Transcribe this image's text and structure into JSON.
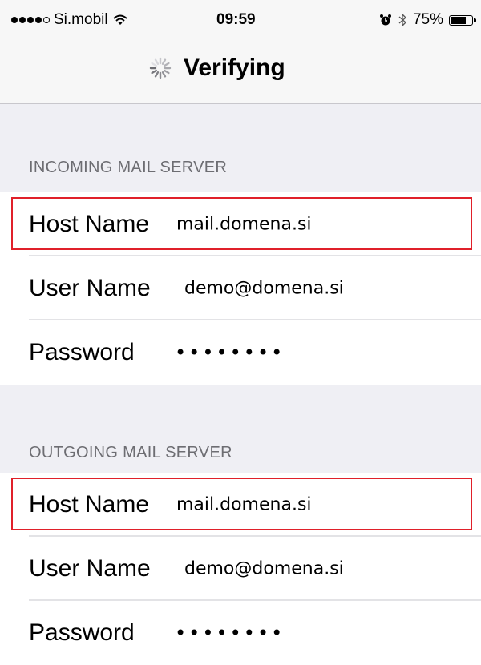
{
  "status_bar": {
    "carrier": "Si.mobil",
    "time": "09:59",
    "battery": "75%",
    "battery_level": 0.75,
    "signal_bars_filled": 4,
    "signal_bars_total": 5
  },
  "nav": {
    "title": "Verifying"
  },
  "incoming": {
    "header": "INCOMING MAIL SERVER",
    "host_label": "Host Name",
    "host_value": "mail.domena.si",
    "user_label": "User Name",
    "user_value": "demo@domena.si",
    "password_label": "Password",
    "password_value": "••••••••"
  },
  "outgoing": {
    "header": "OUTGOING MAIL SERVER",
    "host_label": "Host Name",
    "host_value": "mail.domena.si",
    "user_label": "User Name",
    "user_value": "demo@domena.si",
    "password_label": "Password",
    "password_value": "••••••••"
  },
  "colors": {
    "highlight": "#e0202a",
    "background": "#efeff4"
  }
}
